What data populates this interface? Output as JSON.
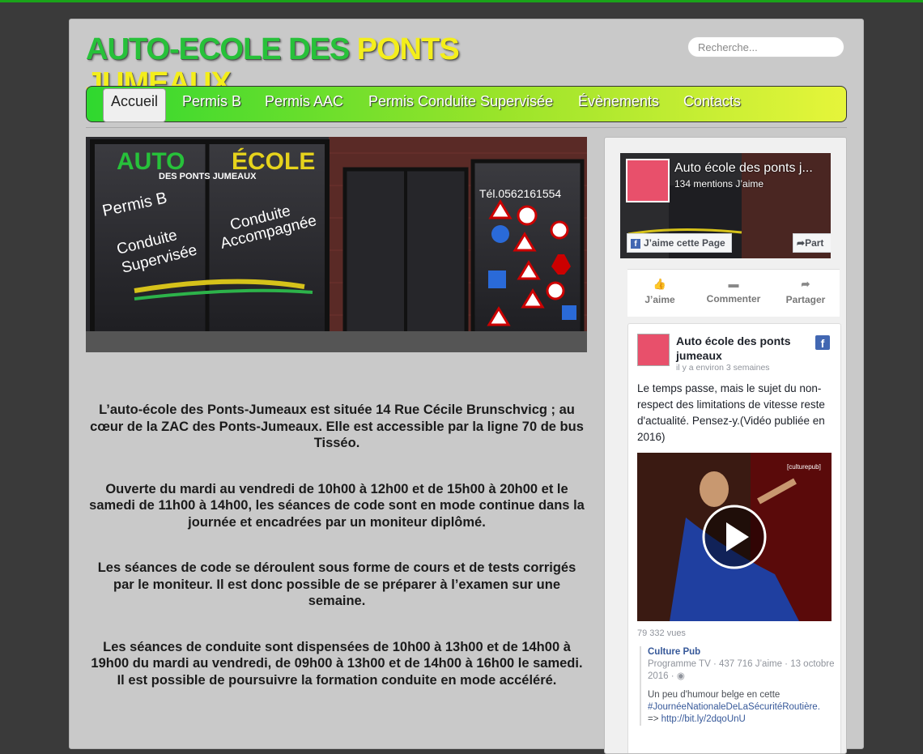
{
  "header": {
    "logo_part1": "AUTO-ECOLE DES",
    "logo_part2": "PONTS JUMEAUX",
    "search_placeholder": "Recherche..."
  },
  "nav": {
    "items": [
      {
        "label": "Accueil",
        "active": true
      },
      {
        "label": "Permis B"
      },
      {
        "label": "Permis AAC"
      },
      {
        "label": "Permis Conduite Supervisée"
      },
      {
        "label": "Évènements"
      },
      {
        "label": "Contacts"
      }
    ]
  },
  "hero": {
    "sign_auto": "AUTO",
    "sign_ecole": "ÉCOLE",
    "sign_sub": "DES PONTS JUMEAUX",
    "permis_b": "Permis B",
    "conduite_supervisee_1": "Conduite",
    "conduite_supervisee_2": "Supervisée",
    "conduite_accompagnee_1": "Conduite",
    "conduite_accompagnee_2": "Accompagnée",
    "phone": "Tél.0562161554"
  },
  "main": {
    "paragraphs": [
      "L’auto-école des Ponts-Jumeaux est située 14 Rue Cécile Brunschvicg ; au cœur de la ZAC des Ponts-Jumeaux. Elle est accessible par la ligne 70 de bus Tisséo.",
      "Ouverte du mardi au vendredi de 10h00 à 12h00 et de 15h00 à 20h00 et le samedi de 11h00 à 14h00, les séances de code sont en mode continue dans la journée et encadrées par un moniteur diplômé.",
      "Les séances de code se déroulent sous forme de cours et de tests corrigés par le moniteur. Il est donc possible de se préparer à l’examen sur une semaine.",
      "Les séances de conduite sont dispensées de 10h00 à 13h00 et de 14h00 à 19h00 du mardi au vendredi, de 09h00 à 13h00 et de 14h00 à 16h00 le samedi. Il est possible de poursuivre la formation conduite en mode accéléré."
    ]
  },
  "facebook": {
    "page_name": "Auto école des ponts j...",
    "likes": "134 mentions J’aime",
    "like_button": "J’aime cette Page",
    "share_button": "Part",
    "actions": {
      "like": "J’aime",
      "comment": "Commenter",
      "share": "Partager"
    },
    "post": {
      "author": "Auto école des ponts jumeaux",
      "time": "il y a environ 3 semaines",
      "badge": "f",
      "text": "Le temps passe, mais le sujet du non-respect des limitations de vitesse reste d'actualité. Pensez-y.(Vidéo publiée en 2016)",
      "video_brand": "[culturepub]",
      "views": "79 332 vues",
      "shared_source": "Culture Pub",
      "shared_meta": "Programme TV · 437 716 J’aime · 13 octobre 2016 ·",
      "shared_text": "Un peu d'humour belge en cette",
      "shared_hashtag": "#JournéeNationaleDeLaSécuritéRoutière.",
      "shared_link_prefix": "=>",
      "shared_link": "http://bit.ly/2dqoUnU"
    }
  },
  "colors": {
    "logo_green": "#27c13a",
    "logo_yellow": "#f4ee1b",
    "top_line": "#1aa31a",
    "fb_blue": "#4267b2"
  }
}
